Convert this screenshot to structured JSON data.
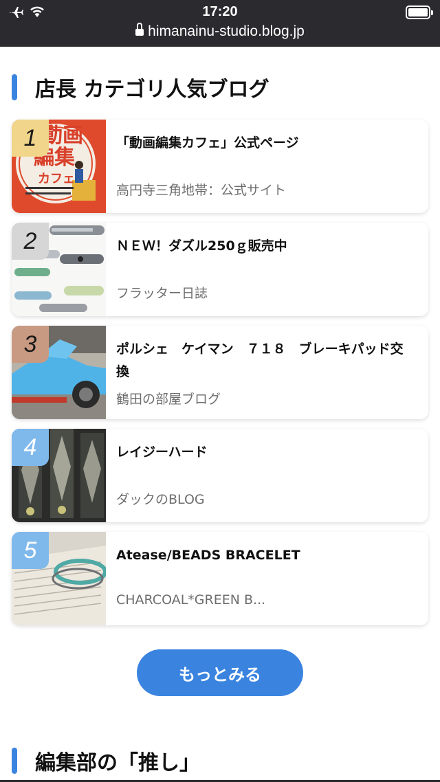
{
  "status": {
    "time": "17:20",
    "url": "himanainu-studio.blog.jp"
  },
  "section1": {
    "title": "店長 カテゴリ人気ブログ"
  },
  "ranking": [
    {
      "rank": "1",
      "title": "「動画編集カフェ」公式ページ",
      "sub": "高円寺三角地帯：公式サイト",
      "badge_color": "#f0d58a"
    },
    {
      "rank": "2",
      "title": "ＮＥＷ！ダズル250ｇ販売中",
      "sub": "フラッター日誌",
      "badge_color": "#d6d6d6"
    },
    {
      "rank": "3",
      "title": "ポルシェ　ケイマン　７１８　ブレーキパッド交換",
      "sub": "鶴田の部屋ブログ",
      "badge_color": "#c99a82"
    },
    {
      "rank": "4",
      "title": "レイジーハード",
      "sub": "ダックのBLOG",
      "badge_color": "#7fb9ec"
    },
    {
      "rank": "5",
      "title": "Atease/BEADS BRACELET",
      "sub": "CHARCOAL*GREEN B...",
      "badge_color": "#7fb9ec"
    }
  ],
  "thumb_text": {
    "cafe_line1": "動画",
    "cafe_line2": "編集",
    "cafe_line3": "カフェ"
  },
  "more_button": {
    "label": "もっとみる"
  },
  "section2": {
    "title": "編集部の「推し」"
  },
  "colors": {
    "accent": "#3a84e0",
    "statusbar": "#2b2b2f"
  }
}
